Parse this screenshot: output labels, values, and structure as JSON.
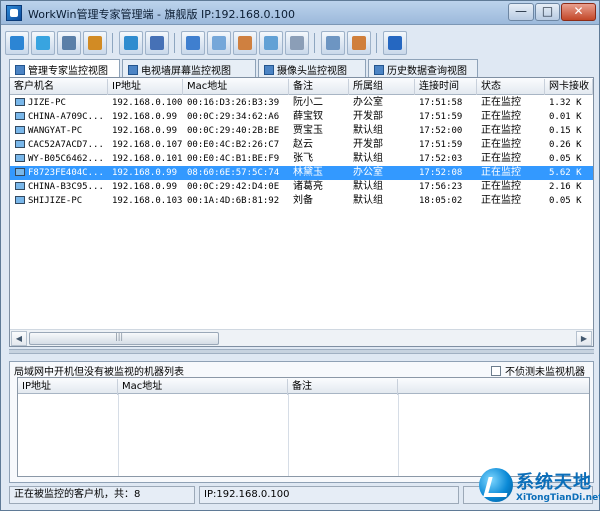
{
  "window": {
    "title": "WorkWin管理专家管理端 - 旗舰版 IP:192.168.0.100",
    "minimize": "—",
    "maximize": "□",
    "close": "✕"
  },
  "toolbar": {
    "buttons": [
      {
        "icon": "layers-icon",
        "color": "#2c85d4"
      },
      {
        "icon": "globe-icon",
        "color": "#38a4e0"
      },
      {
        "icon": "monitor-settings-icon",
        "color": "#5a7fa8"
      },
      {
        "icon": "tools-icon",
        "color": "#d28b24"
      },
      {
        "icon": "chart-icon",
        "color": "#2f8ccf"
      },
      {
        "icon": "connect-icon",
        "color": "#4671b6"
      },
      {
        "icon": "screen-icon",
        "color": "#3f7fcf"
      },
      {
        "icon": "message-icon",
        "color": "#75a7d9"
      },
      {
        "icon": "picture-icon",
        "color": "#cf8040"
      },
      {
        "icon": "copy-icon",
        "color": "#62a1d5"
      },
      {
        "icon": "disk-icon",
        "color": "#8b9eb7"
      },
      {
        "icon": "document-icon",
        "color": "#6d95c2"
      },
      {
        "icon": "user-icon",
        "color": "#d07f3b"
      },
      {
        "icon": "help-icon",
        "color": "#2567c1"
      }
    ]
  },
  "tabs": [
    {
      "label": "管理专家监控视图",
      "active": true
    },
    {
      "label": "电视墙屏幕监控视图",
      "active": false
    },
    {
      "label": "摄像头监控视图",
      "active": false
    },
    {
      "label": "历史数据查询视图",
      "active": false
    }
  ],
  "main_table": {
    "headers": [
      "客户机名",
      "IP地址",
      "Mac地址",
      "备注",
      "所属组",
      "连接时间",
      "状态",
      "网卡接收"
    ],
    "rows": [
      {
        "name": "JIZE-PC",
        "ip": "192.168.0.100",
        "mac": "00:16:D3:26:B3:39",
        "note": "阮小二",
        "group": "办公室",
        "time": "17:51:58",
        "status": "正在监控",
        "rx": "1.32 K"
      },
      {
        "name": "CHINA-A709C...",
        "ip": "192.168.0.99",
        "mac": "00:0C:29:34:62:A6",
        "note": "薛宝钗",
        "group": "开发部",
        "time": "17:51:59",
        "status": "正在监控",
        "rx": "0.01 K"
      },
      {
        "name": "WANGYAT-PC",
        "ip": "192.168.0.99",
        "mac": "00:0C:29:40:2B:BE",
        "note": "贾宝玉",
        "group": "默认组",
        "time": "17:52:00",
        "status": "正在监控",
        "rx": "0.15 K"
      },
      {
        "name": "CAC52A7ACD7...",
        "ip": "192.168.0.107",
        "mac": "00:E0:4C:B2:26:C7",
        "note": "赵云",
        "group": "开发部",
        "time": "17:51:59",
        "status": "正在监控",
        "rx": "0.26 K"
      },
      {
        "name": "WY-B05C6462...",
        "ip": "192.168.0.101",
        "mac": "00:E0:4C:B1:BE:F9",
        "note": "张飞",
        "group": "默认组",
        "time": "17:52:03",
        "status": "正在监控",
        "rx": "0.05 K"
      },
      {
        "name": "F8723FE404C...",
        "ip": "192.168.0.99",
        "mac": "08:60:6E:57:5C:74",
        "note": "林黛玉",
        "group": "办公室",
        "time": "17:52:08",
        "status": "正在监控",
        "rx": "5.62 K",
        "selected": true
      },
      {
        "name": "CHINA-B3C95...",
        "ip": "192.168.0.99",
        "mac": "00:0C:29:42:D4:0E",
        "note": "诸葛亮",
        "group": "默认组",
        "time": "17:56:23",
        "status": "正在监控",
        "rx": "2.16 K"
      },
      {
        "name": "SHIJIZE-PC",
        "ip": "192.168.0.103",
        "mac": "00:1A:4D:6B:81:92",
        "note": "刘备",
        "group": "默认组",
        "time": "18:05:02",
        "status": "正在监控",
        "rx": "0.05 K"
      }
    ],
    "scroll_left": "◀",
    "scroll_right": "▶"
  },
  "unmonitored": {
    "title": "局域网中开机但没有被监视的机器列表",
    "checkbox_label": "不侦测未监视机器",
    "headers": [
      "IP地址",
      "Mac地址",
      "备注"
    ]
  },
  "status": {
    "clients": "正在被监控的客户机，共：8",
    "ip": "IP:192.168.0.100"
  },
  "watermark": {
    "title": "系统天地",
    "url": "XiTongTianDi.net"
  }
}
